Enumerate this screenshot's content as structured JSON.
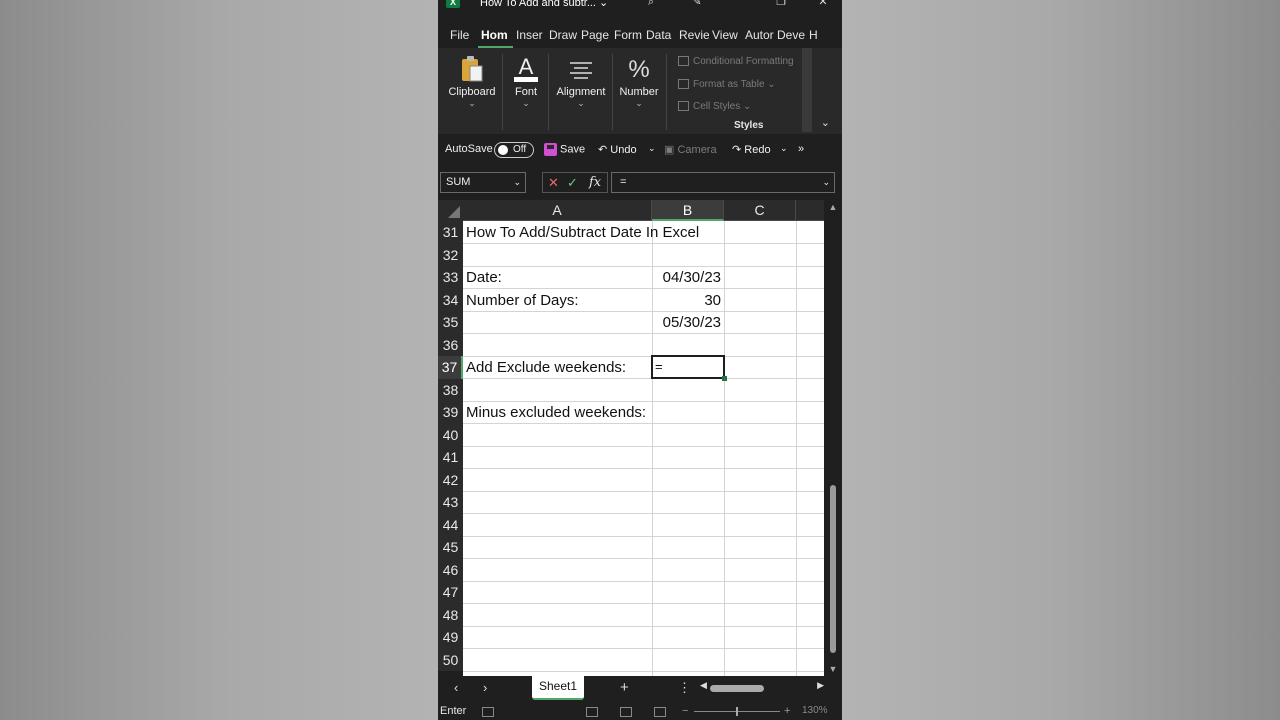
{
  "window": {
    "title": "How To Add and subtr...",
    "logo": "X"
  },
  "tabs": [
    "File",
    "Hom",
    "Inser",
    "Draw",
    "Page",
    "Form",
    "Data",
    "Revie",
    "View",
    "Autor",
    "Deve",
    "H"
  ],
  "ribbon": {
    "clipboard": "Clipboard",
    "font": "Font",
    "alignment": "Alignment",
    "number": "Number",
    "styles": {
      "label": "Styles",
      "conditional": "Conditional Formatting",
      "format_table": "Format as Table",
      "cell_styles": "Cell Styles"
    }
  },
  "qat": {
    "autosave": "AutoSave",
    "toggle": "Off",
    "save": "Save",
    "undo": "Undo",
    "camera": "Camera",
    "redo": "Redo",
    "more": "»"
  },
  "formula_bar": {
    "name_box": "SUM",
    "cancel": "✕",
    "enter": "✓",
    "fx": "fx",
    "value": "="
  },
  "grid": {
    "columns": [
      "A",
      "B",
      "C"
    ],
    "selected_column": "B",
    "rows": [
      "31",
      "32",
      "33",
      "34",
      "35",
      "36",
      "37",
      "38",
      "39",
      "40",
      "41",
      "42",
      "43",
      "44",
      "45",
      "46",
      "47",
      "48",
      "49",
      "50"
    ],
    "selected_row": "37",
    "cells": {
      "a31": "How To Add/Subtract Date In Excel",
      "a33": "Date:",
      "b33": "04/30/23",
      "a34": "Number of Days:",
      "b34": "30",
      "b35": "05/30/23",
      "a37": "Add Exclude weekends:",
      "b37": "=",
      "a39": "Minus excluded weekends:"
    }
  },
  "sheets": {
    "active": "Sheet1",
    "add": "+"
  },
  "status": {
    "mode": "Enter",
    "zoom": "130%"
  },
  "colors": {
    "accent": "#4ea96b",
    "excel_green": "#107c41",
    "save_icon": "#d14fd1"
  }
}
